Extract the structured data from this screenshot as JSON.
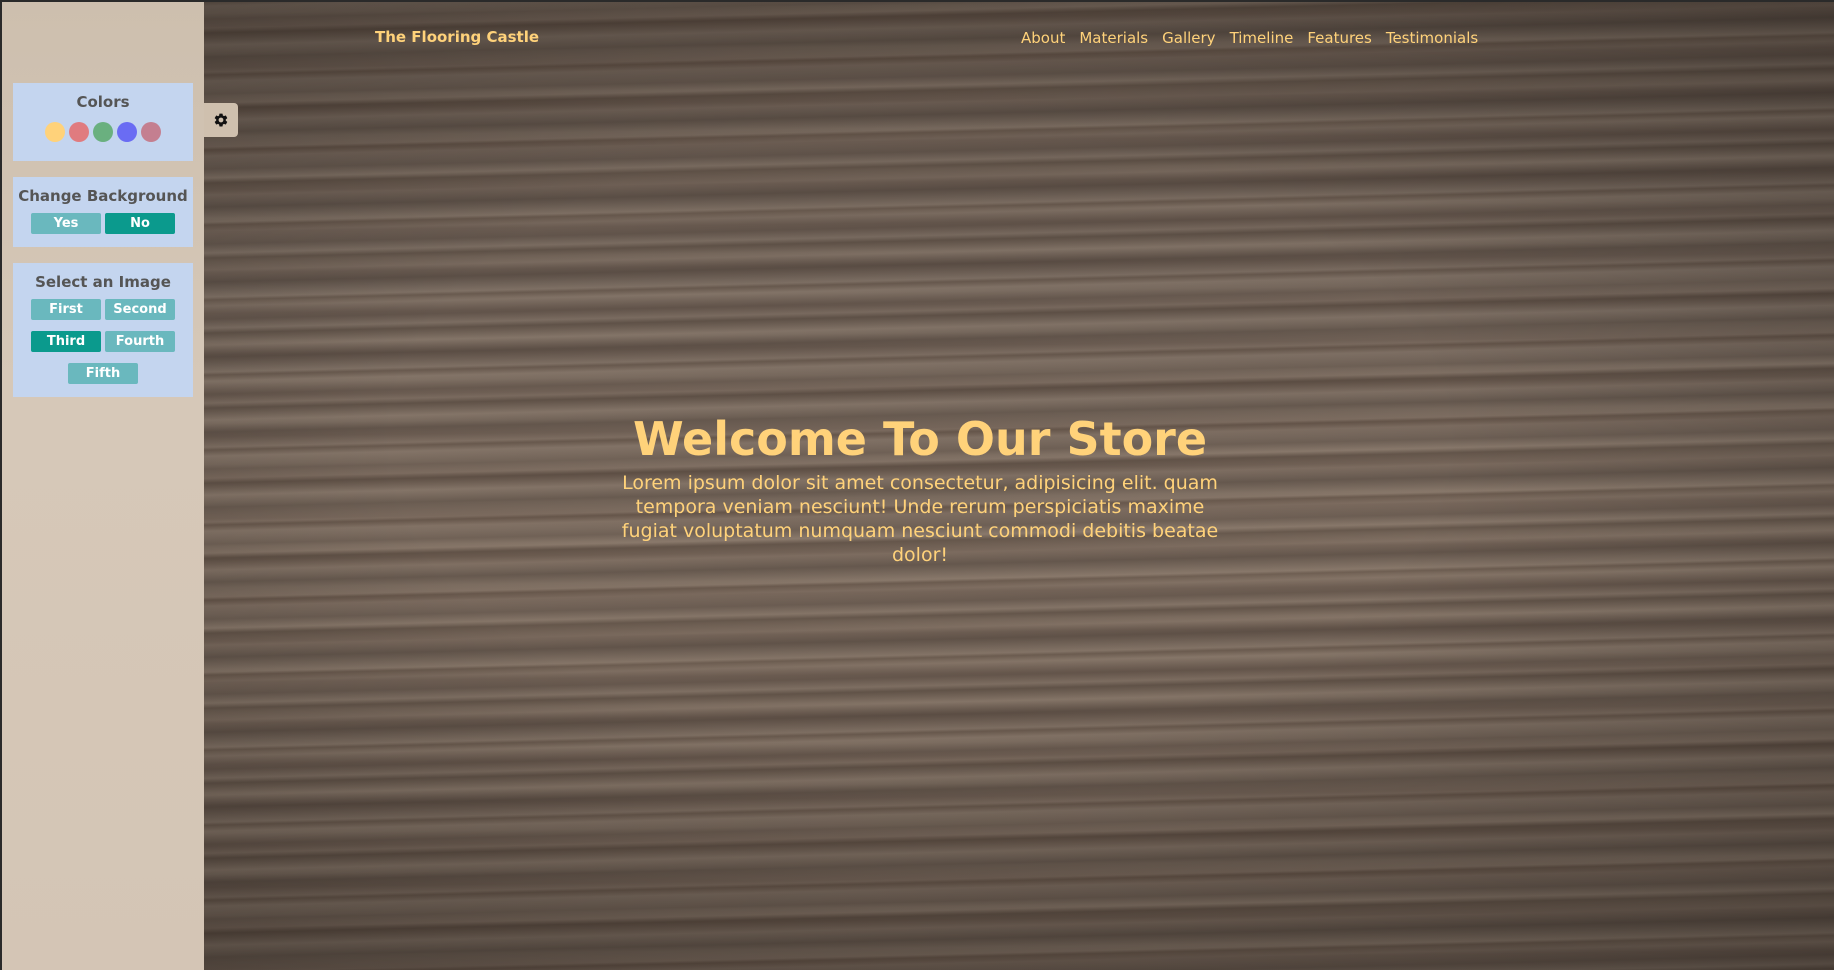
{
  "header": {
    "brand": "The Flooring Castle",
    "nav": [
      "About",
      "Materials",
      "Gallery",
      "Timeline",
      "Features",
      "Testimonials"
    ]
  },
  "hero": {
    "title": "Welcome To Our Store",
    "text": "Lorem ipsum dolor sit amet consectetur, adipisicing elit. quam tempora veniam nesciunt! Unde rerum perspiciatis maxime fugiat voluptatum numquam nesciunt commodi debitis beatae dolor!"
  },
  "settings": {
    "gear_icon": "gear-icon",
    "colors": {
      "title": "Colors",
      "swatches": [
        "#ffd27a",
        "#e07b7f",
        "#6ab07f",
        "#6a6cf3",
        "#c47f90"
      ]
    },
    "background": {
      "title": "Change Background",
      "options": [
        "Yes",
        "No"
      ],
      "selected": "No"
    },
    "images": {
      "title": "Select an Image",
      "options": [
        "First",
        "Second",
        "Third",
        "Fourth",
        "Fifth"
      ],
      "selected": "Third"
    }
  },
  "theme": {
    "accent": "#ffd27a",
    "button": "#6ab8be",
    "button_active": "#0b9a8d",
    "panel": "#c4d5ef"
  }
}
